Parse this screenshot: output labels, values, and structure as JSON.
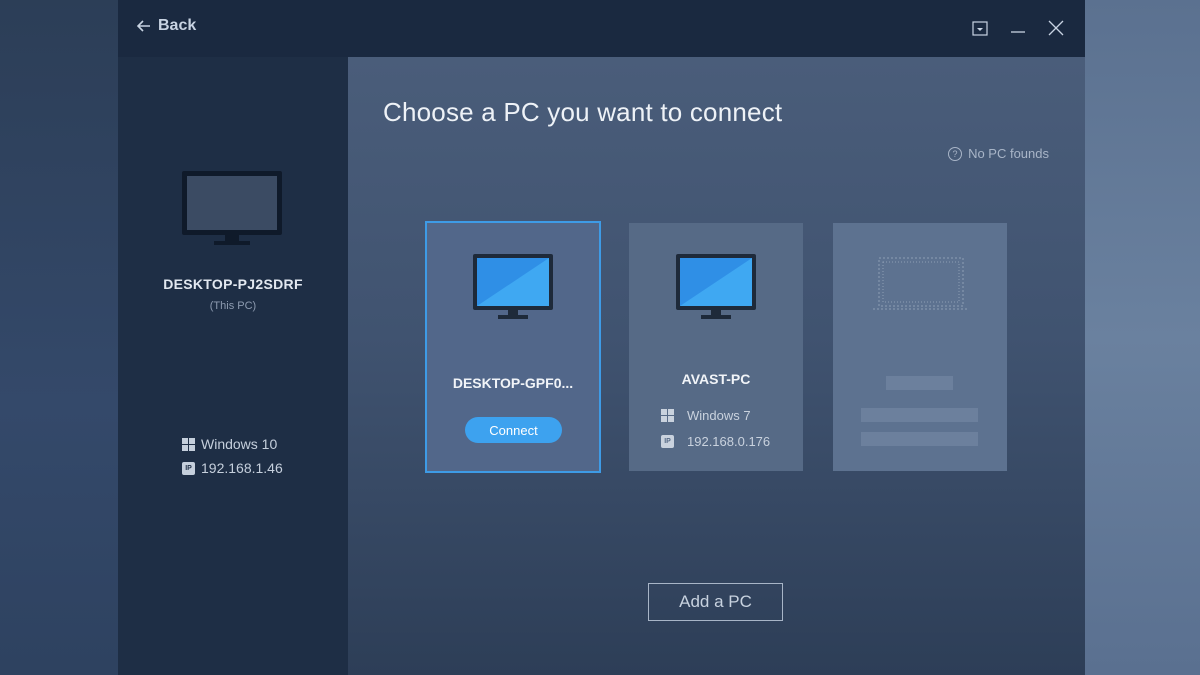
{
  "titlebar": {
    "back_label": "Back"
  },
  "this_pc": {
    "name": "DESKTOP-PJ2SDRF",
    "subtitle": "(This PC)",
    "os": "Windows 10",
    "ip": "192.168.1.46"
  },
  "main": {
    "heading": "Choose a PC you want to connect",
    "status": "No PC founds",
    "add_pc_label": "Add a PC"
  },
  "pcs": [
    {
      "name": "DESKTOP-GPF0...",
      "selected": true,
      "connect_label": "Connect"
    },
    {
      "name": "AVAST-PC",
      "selected": false,
      "os": "Windows 7",
      "ip": "192.168.0.176"
    }
  ],
  "icons": [
    "back-arrow-icon",
    "dropdown-icon",
    "minimize-icon",
    "close-icon",
    "monitor-icon",
    "windows-icon",
    "ip-icon",
    "question-icon"
  ],
  "colors": {
    "accent": "#3da2ef",
    "selected_border": "#3e9be6",
    "titlebar": "#1a2940"
  }
}
